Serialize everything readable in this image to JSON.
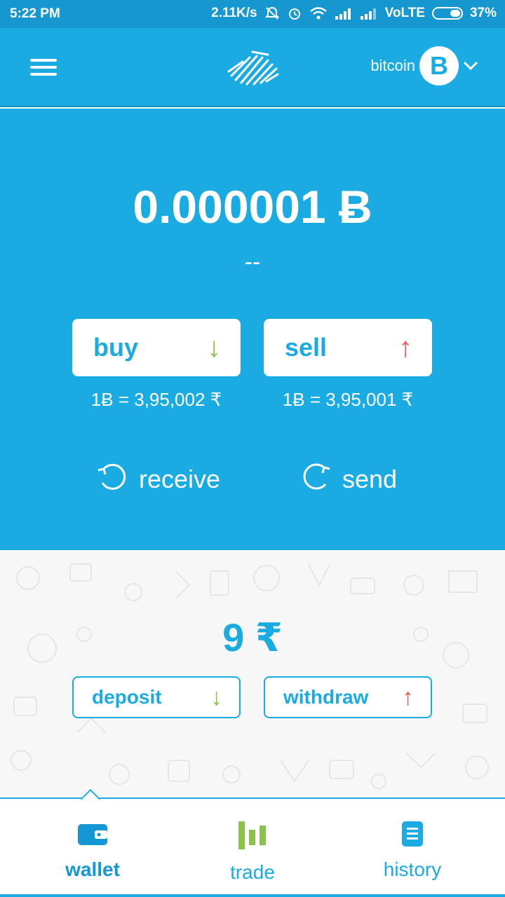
{
  "status_bar": {
    "time": "5:22 PM",
    "speed": "2.11K/s",
    "network": "VoLTE",
    "battery": "37%"
  },
  "app_bar": {
    "currency_label": "bitcoin",
    "currency_symbol": "B"
  },
  "wallet": {
    "balance": "0.000001 Ƀ",
    "fiat_value": "--",
    "buy": {
      "label": "buy",
      "arrow": "↓",
      "rate": "1Ƀ = 3,95,002 ₹"
    },
    "sell": {
      "label": "sell",
      "arrow": "↑",
      "rate": "1Ƀ = 3,95,001 ₹"
    },
    "receive_label": "receive",
    "send_label": "send"
  },
  "inr": {
    "balance": "9 ₹",
    "deposit": {
      "label": "deposit",
      "arrow": "↓"
    },
    "withdraw": {
      "label": "withdraw",
      "arrow": "↑"
    }
  },
  "tabs": [
    {
      "label": "wallet",
      "icon": "wallet-icon",
      "active": true
    },
    {
      "label": "trade",
      "icon": "bar-chart-icon",
      "active": false
    },
    {
      "label": "history",
      "icon": "document-icon",
      "active": false
    }
  ],
  "colors": {
    "primary": "#1aabe3",
    "status_bar": "#1797cf",
    "buy_arrow": "#8bc34a",
    "sell_arrow": "#f25b5b",
    "trade_icon": "#8bc34a"
  }
}
